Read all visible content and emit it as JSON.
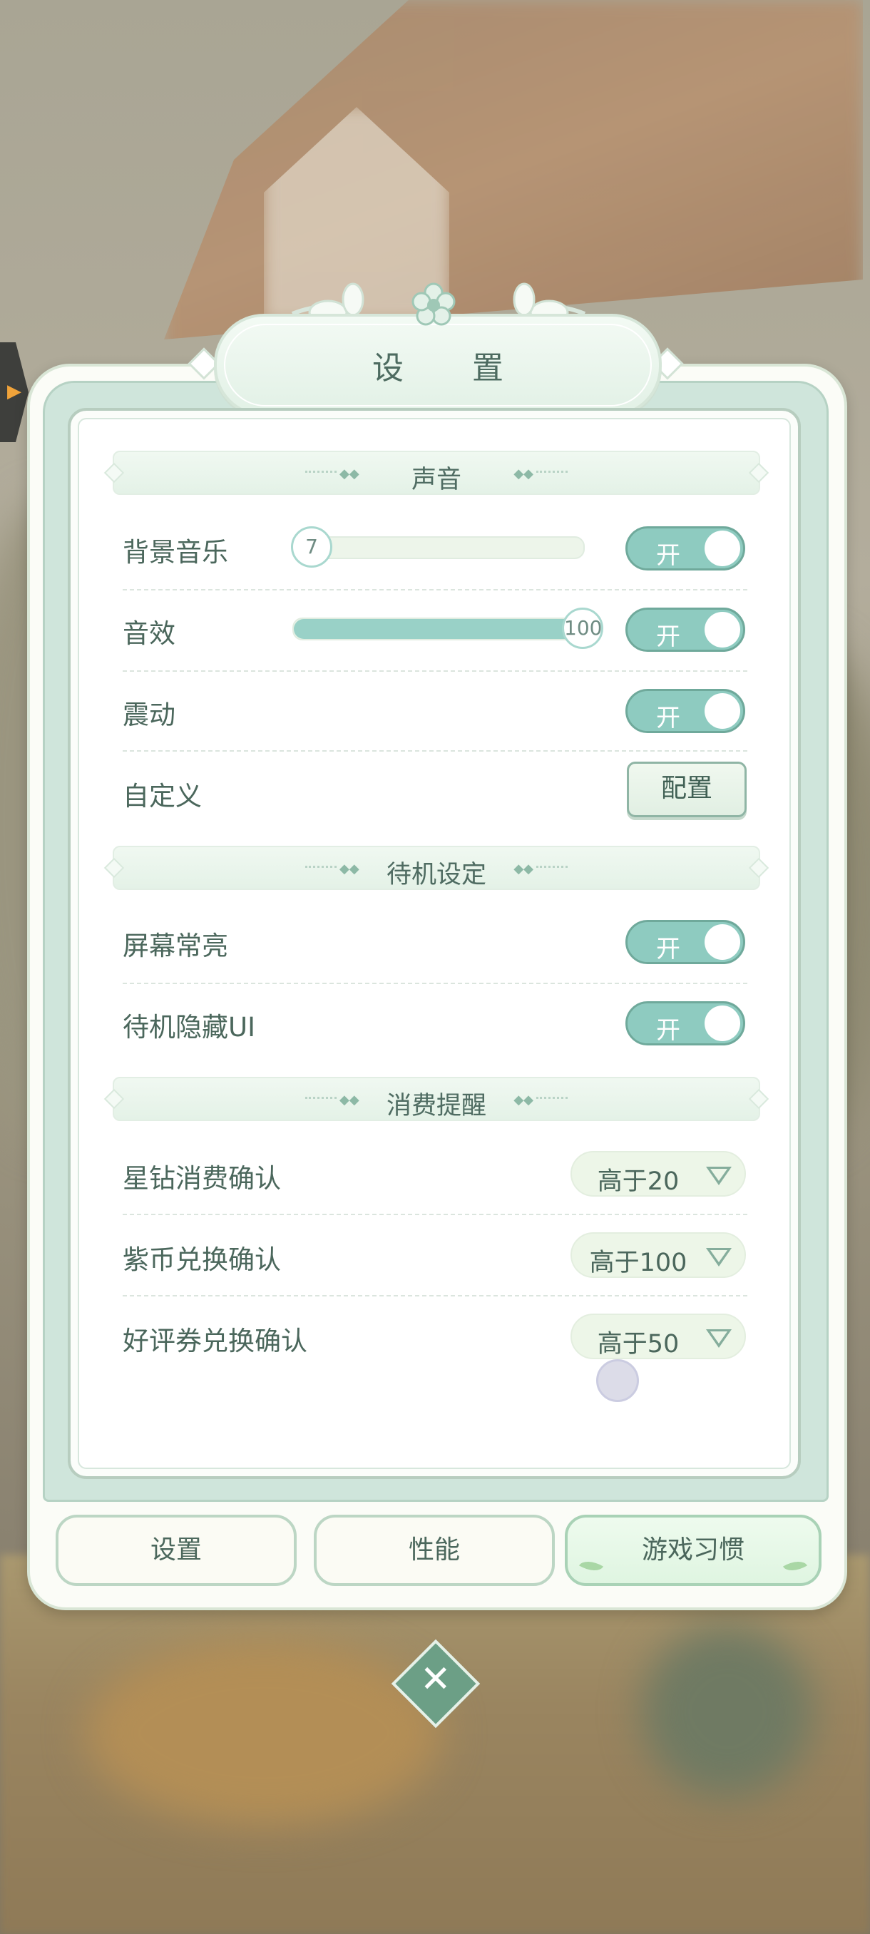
{
  "dialog": {
    "title": "设　置"
  },
  "sections": {
    "sound": "声音",
    "standby": "待机设定",
    "spending": "消费提醒"
  },
  "rows": {
    "bgm": {
      "label": "背景音乐",
      "slider_value": "7",
      "slider_fraction": 0.07,
      "toggle": "开"
    },
    "sfx": {
      "label": "音效",
      "slider_value": "100",
      "slider_fraction": 1.0,
      "toggle": "开"
    },
    "vibration": {
      "label": "震动",
      "toggle": "开"
    },
    "custom": {
      "label": "自定义",
      "button": "配置"
    },
    "screen_on": {
      "label": "屏幕常亮",
      "toggle": "开"
    },
    "hide_ui": {
      "label": "待机隐藏UI",
      "toggle": "开"
    },
    "star_diamond": {
      "label": "星钻消费确认",
      "value": "高于20"
    },
    "purple_coin": {
      "label": "紫币兑换确认",
      "value": "高于100"
    },
    "review_ticket": {
      "label": "好评券兑换确认",
      "value": "高于50"
    }
  },
  "tabs": [
    {
      "label": "设置",
      "active": false
    },
    {
      "label": "性能",
      "active": false
    },
    {
      "label": "游戏习惯",
      "active": true
    }
  ],
  "icons": {
    "edge_tab": "chevron-right-icon",
    "close": "close-icon",
    "dropdown": "triangle-down-icon"
  },
  "colors": {
    "accent": "#8ecbc0",
    "text": "#4b675c",
    "panel_border": "#b7cdbf"
  }
}
